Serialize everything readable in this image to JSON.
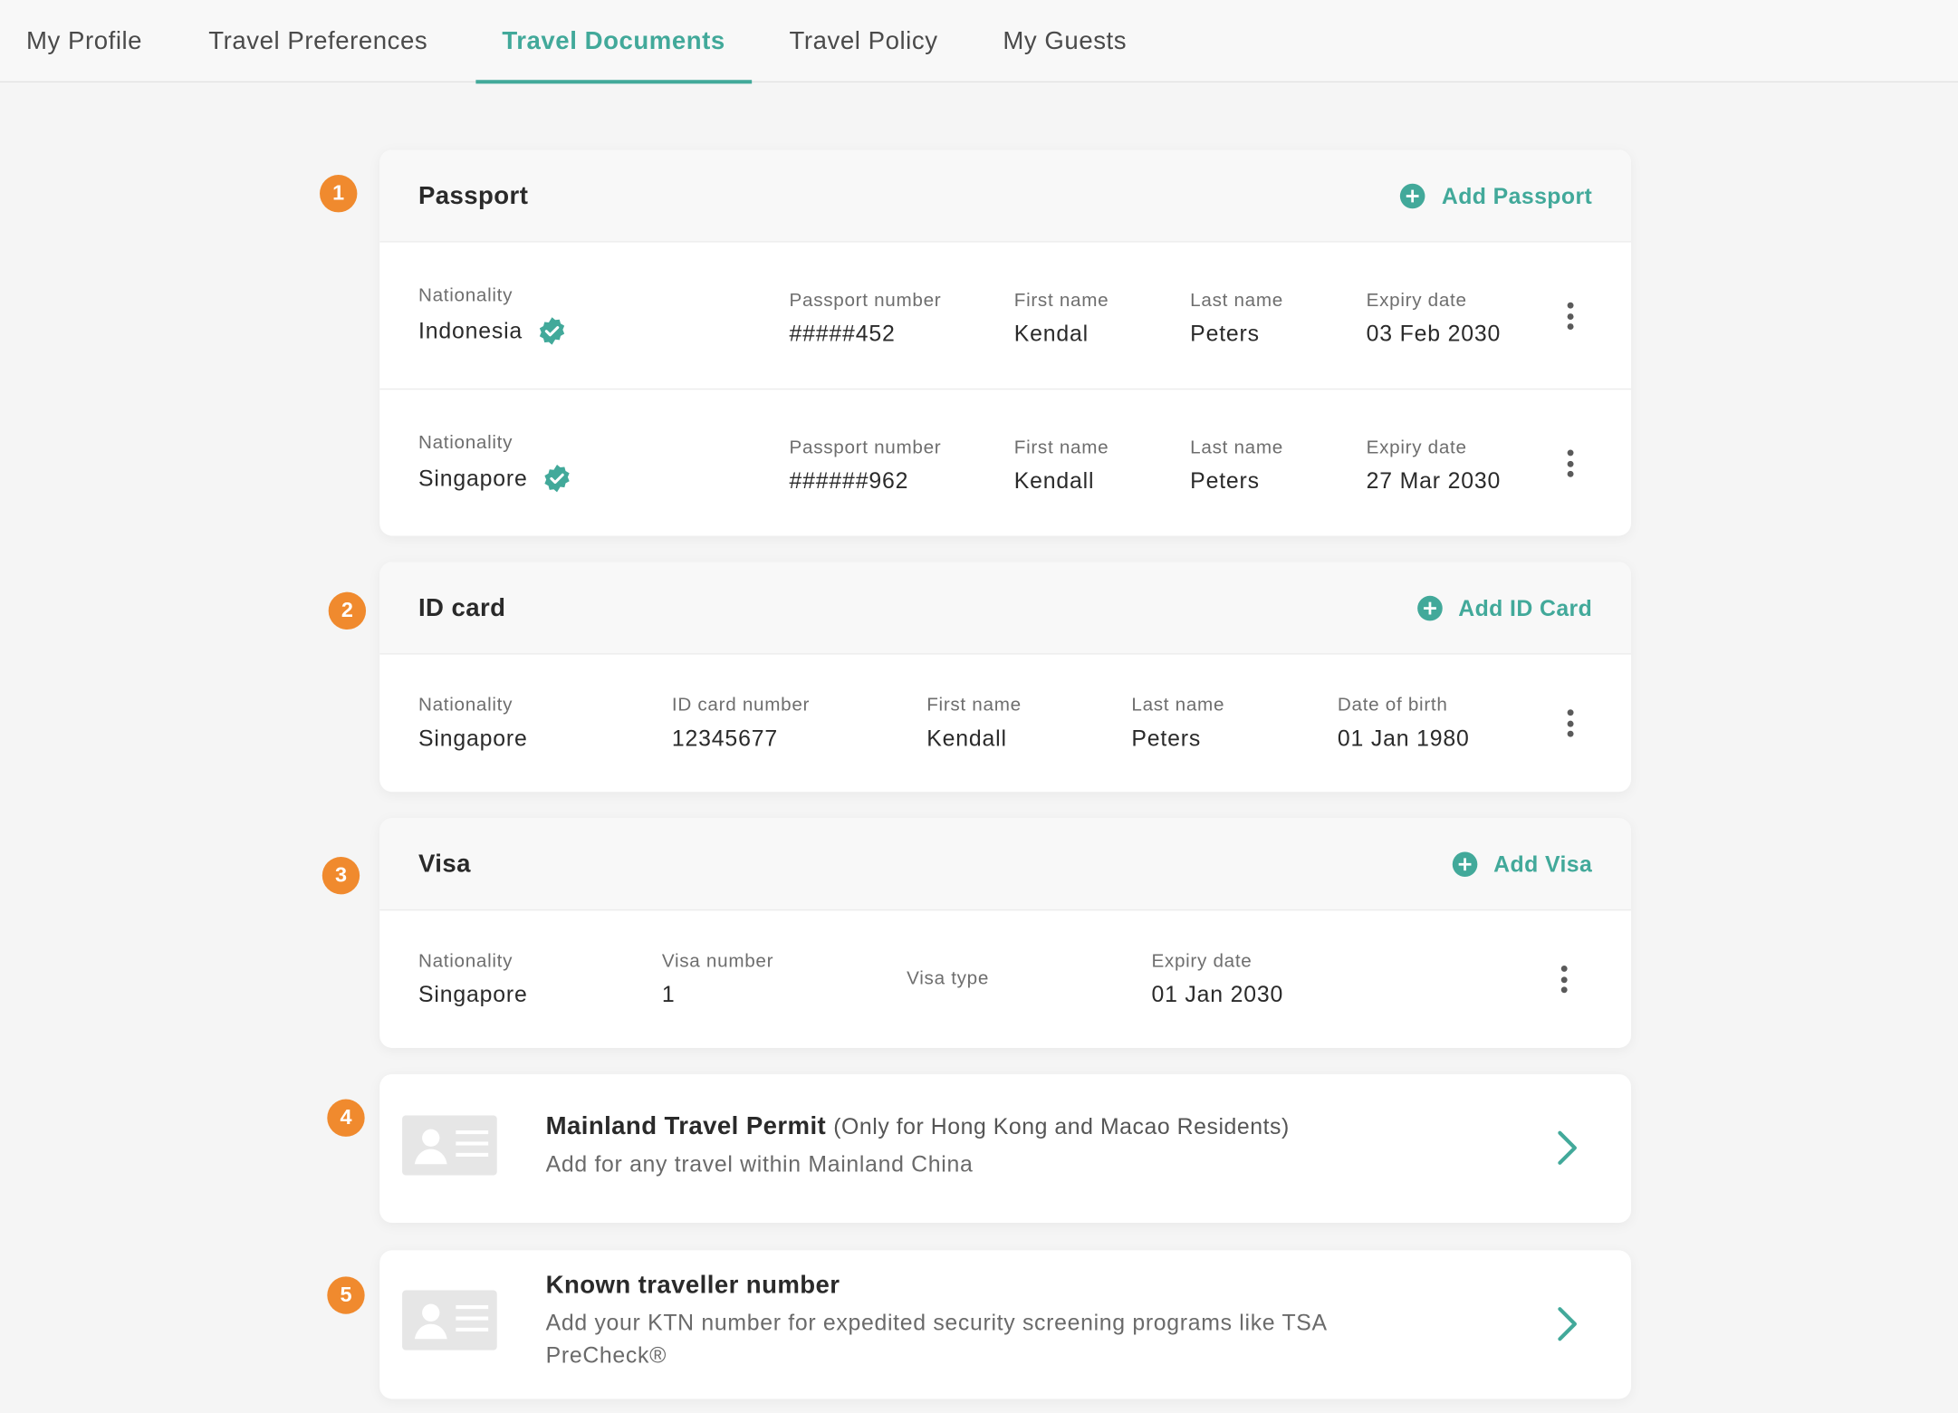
{
  "tabs": [
    {
      "label": "My Profile"
    },
    {
      "label": "Travel Preferences"
    },
    {
      "label": "Travel Documents"
    },
    {
      "label": "Travel Policy"
    },
    {
      "label": "My Guests"
    }
  ],
  "active_tab": "Travel Documents",
  "accent_color": "#42a99a",
  "marker_color": "#f08a2e",
  "markers": [
    "1",
    "2",
    "3",
    "4",
    "5"
  ],
  "passport": {
    "title": "Passport",
    "add_label": "Add Passport",
    "labels": {
      "nationality": "Nationality",
      "number": "Passport number",
      "first_name": "First name",
      "last_name": "Last name",
      "expiry": "Expiry date"
    },
    "items": [
      {
        "nationality": "Indonesia",
        "verified": true,
        "number": "#####452",
        "first_name": "Kendal",
        "last_name": "Peters",
        "expiry": "03 Feb 2030"
      },
      {
        "nationality": "Singapore",
        "verified": true,
        "number": "######962",
        "first_name": "Kendall",
        "last_name": "Peters",
        "expiry": "27 Mar 2030"
      }
    ]
  },
  "id_card": {
    "title": "ID card",
    "add_label": "Add ID Card",
    "labels": {
      "nationality": "Nationality",
      "number": "ID card number",
      "first_name": "First name",
      "last_name": "Last name",
      "dob": "Date of birth"
    },
    "items": [
      {
        "nationality": "Singapore",
        "number": "12345677",
        "first_name": "Kendall",
        "last_name": "Peters",
        "dob": "01 Jan 1980"
      }
    ]
  },
  "visa": {
    "title": "Visa",
    "add_label": "Add Visa",
    "labels": {
      "nationality": "Nationality",
      "number": "Visa number",
      "type": "Visa type",
      "expiry": "Expiry date"
    },
    "items": [
      {
        "nationality": "Singapore",
        "number": "1",
        "expiry": "01 Jan 2030"
      }
    ]
  },
  "mainland_permit": {
    "title": "Mainland Travel Permit",
    "note": "(Only for Hong Kong and Macao Residents)",
    "subtitle": "Add for any travel within Mainland China"
  },
  "ktn": {
    "title": "Known traveller number",
    "subtitle": "Add your KTN number for expedited security screening programs like TSA PreCheck®"
  }
}
